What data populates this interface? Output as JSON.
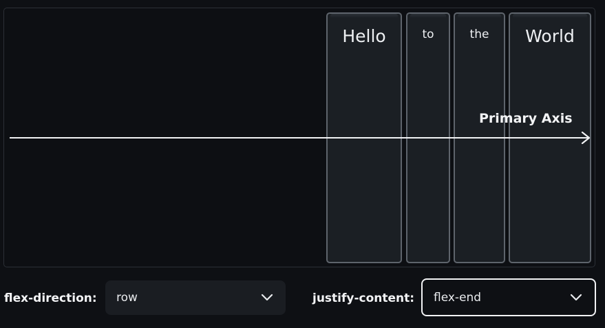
{
  "demo": {
    "items": [
      "Hello",
      "to",
      "the",
      "World"
    ],
    "axis_label": "Primary Axis"
  },
  "controls": {
    "flex_direction": {
      "label": "flex-direction:",
      "value": "row"
    },
    "justify_content": {
      "label": "justify-content:",
      "value": "flex-end"
    }
  },
  "icons": {
    "axis_arrow": "arrow-right-icon",
    "dropdown": "chevron-down-icon"
  }
}
